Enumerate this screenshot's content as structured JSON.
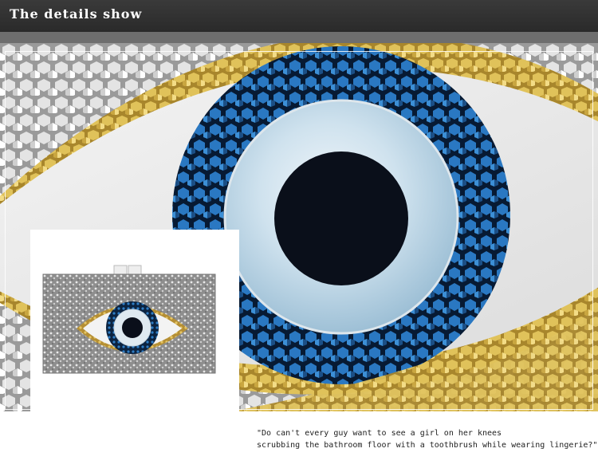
{
  "header": {
    "title": "The details show"
  },
  "quote": {
    "line1": "\"Do can't every guy want to see a girl on her knees",
    "line2": "scrubbing the bathroom floor with a toothbrush while wearing lingerie?\""
  },
  "colors": {
    "header_bg": "#2e2e2e",
    "gold_sequin": "#c9a640",
    "silver_sequin": "#b8b8b8",
    "blue_sequin": "#1f5f9c",
    "pearl_white": "#e8eef3",
    "pearl_blue": "#b9d4e4",
    "pupil": "#0a0f1a"
  }
}
